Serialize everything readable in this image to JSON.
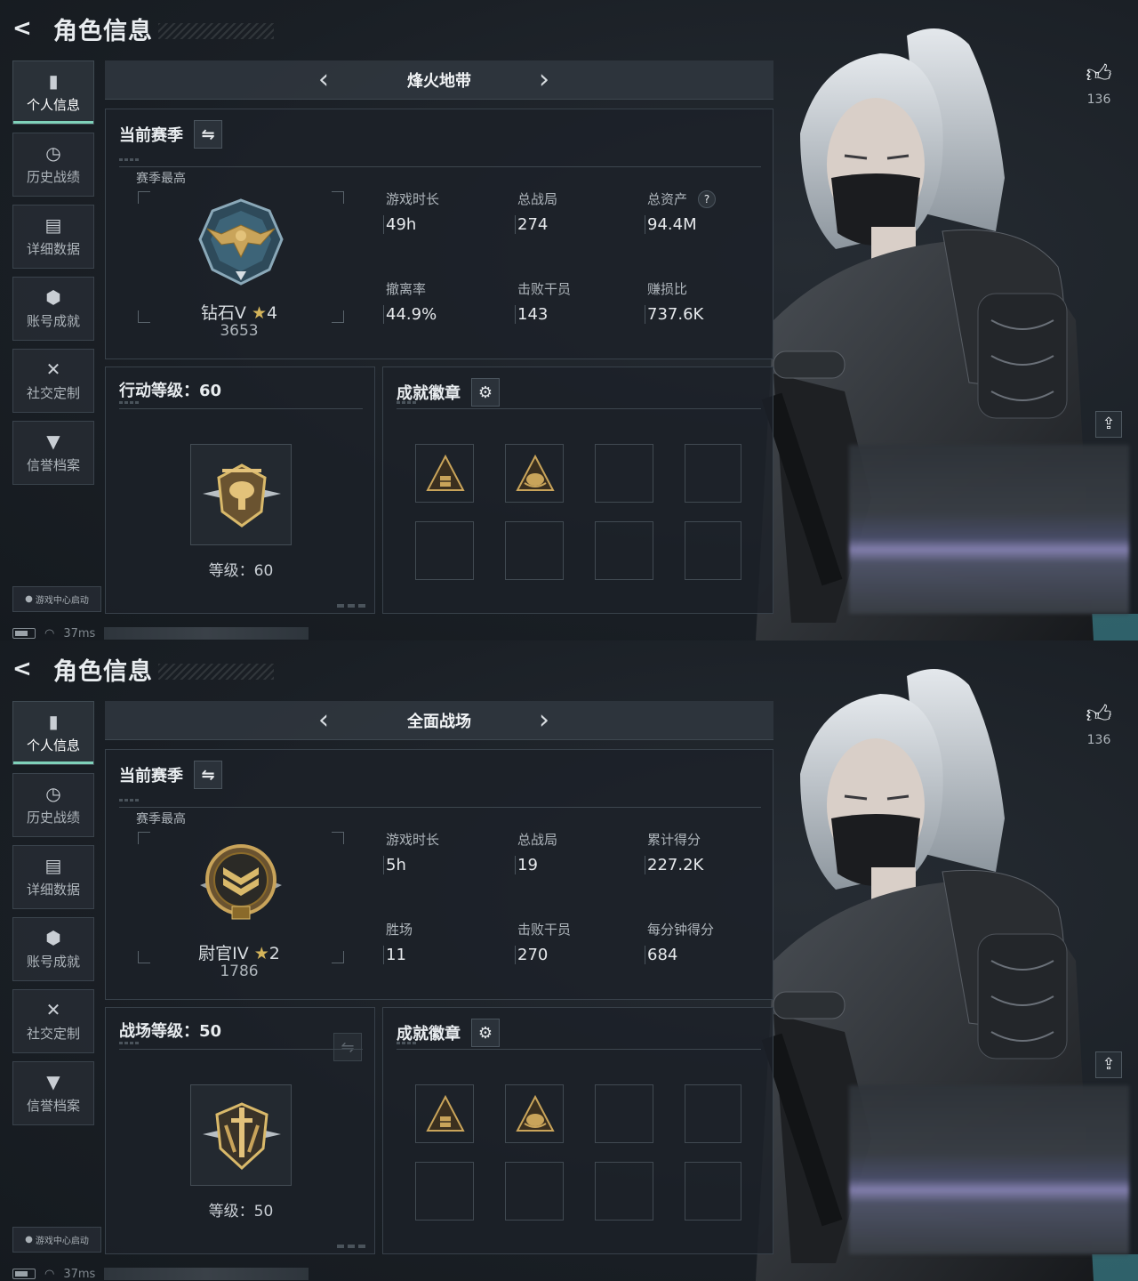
{
  "screens": [
    {
      "page_title": "角色信息",
      "nav": [
        "个人信息",
        "历史战绩",
        "详细数据",
        "账号成就",
        "社交定制",
        "信誉档案"
      ],
      "nav_icons": [
        "bar-chart-icon",
        "clock-icon",
        "folder-icon",
        "hexagon-badge-icon",
        "tools-icon",
        "shield-icon"
      ],
      "game_center": "游戏中心启动",
      "ping": "37ms",
      "mode": "烽火地带",
      "season_title": "当前赛季",
      "season_best_label": "赛季最高",
      "rank_name": "钻石V",
      "rank_stars": "4",
      "rank_points": "3653",
      "stats": [
        {
          "label": "游戏时长",
          "value": "49h"
        },
        {
          "label": "总战局",
          "value": "274"
        },
        {
          "label": "总资产",
          "value": "94.4M",
          "help": "?"
        },
        {
          "label": "撤离率",
          "value": "44.9%"
        },
        {
          "label": "击败干员",
          "value": "143"
        },
        {
          "label": "赚损比",
          "value": "737.6K"
        }
      ],
      "level_title": "行动等级：60",
      "level_text": "等级：60",
      "achievement_title": "成就徽章",
      "likes": "136"
    },
    {
      "page_title": "角色信息",
      "nav": [
        "个人信息",
        "历史战绩",
        "详细数据",
        "账号成就",
        "社交定制",
        "信誉档案"
      ],
      "nav_icons": [
        "bar-chart-icon",
        "clock-icon",
        "folder-icon",
        "hexagon-badge-icon",
        "tools-icon",
        "shield-icon"
      ],
      "game_center": "游戏中心启动",
      "ping": "37ms",
      "mode": "全面战场",
      "season_title": "当前赛季",
      "season_best_label": "赛季最高",
      "rank_name": "尉官IV",
      "rank_stars": "2",
      "rank_points": "1786",
      "stats": [
        {
          "label": "游戏时长",
          "value": "5h"
        },
        {
          "label": "总战局",
          "value": "19"
        },
        {
          "label": "累计得分",
          "value": "227.2K"
        },
        {
          "label": "胜场",
          "value": "11"
        },
        {
          "label": "击败干员",
          "value": "270"
        },
        {
          "label": "每分钟得分",
          "value": "684"
        }
      ],
      "level_title": "战场等级：50",
      "level_text": "等级：50",
      "achievement_title": "成就徽章",
      "likes": "136"
    }
  ],
  "colors": {
    "accent": "#7fd1b9",
    "gold": "#c9a45a",
    "panel": "#1c2128",
    "text": "#c9ced4"
  }
}
